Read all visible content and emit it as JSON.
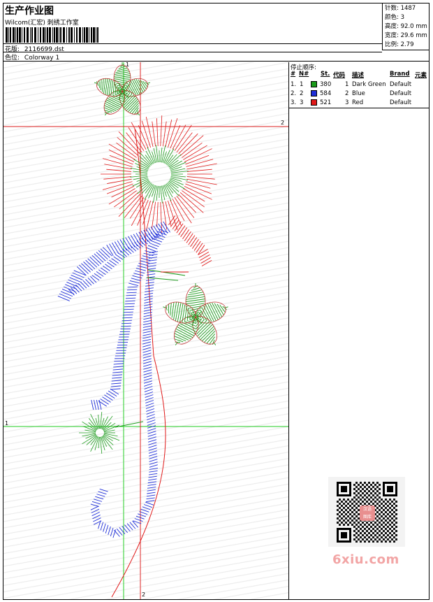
{
  "header": {
    "title": "生产作业图",
    "subtitle": "Wilcom(汇宏) 刺绣工作室",
    "design_label": "花版:",
    "design_file": "2116699.dst",
    "colorway_label": "色位:",
    "colorway": "Colorway 1"
  },
  "stats": {
    "stitches": "针数: 1487",
    "colors": "颜色: 3",
    "height": "高度: 92.0 mm",
    "width": "宽度: 29.6 mm",
    "scale": "比例: 2.79"
  },
  "stop_sequence": {
    "title": "停止顺序:",
    "columns": [
      "#",
      "N#",
      "St.",
      "代码",
      "描述",
      "Brand",
      "元素"
    ],
    "rows": [
      {
        "index": "1.",
        "n": "1",
        "st": "380",
        "code": "1",
        "desc": "Dark Green",
        "brand": "Default",
        "color": "#1a9a1a"
      },
      {
        "index": "2.",
        "n": "2",
        "st": "584",
        "code": "2",
        "desc": "Blue",
        "brand": "Default",
        "color": "#1f2fd8"
      },
      {
        "index": "3.",
        "n": "3",
        "st": "521",
        "code": "3",
        "desc": "Red",
        "brand": "Default",
        "color": "#e01818"
      }
    ]
  },
  "guides": {
    "v1": "1",
    "h2": "2",
    "h1": "1",
    "v2": "2"
  },
  "watermark": {
    "badge_top": "汉语",
    "badge_bottom": "图库",
    "text": "6xiu.com"
  },
  "colors": {
    "green": "#1a9a1a",
    "blue": "#1f2fd8",
    "red": "#e01818",
    "guide_green": "#22cc22",
    "guide_red": "#dd2222"
  }
}
